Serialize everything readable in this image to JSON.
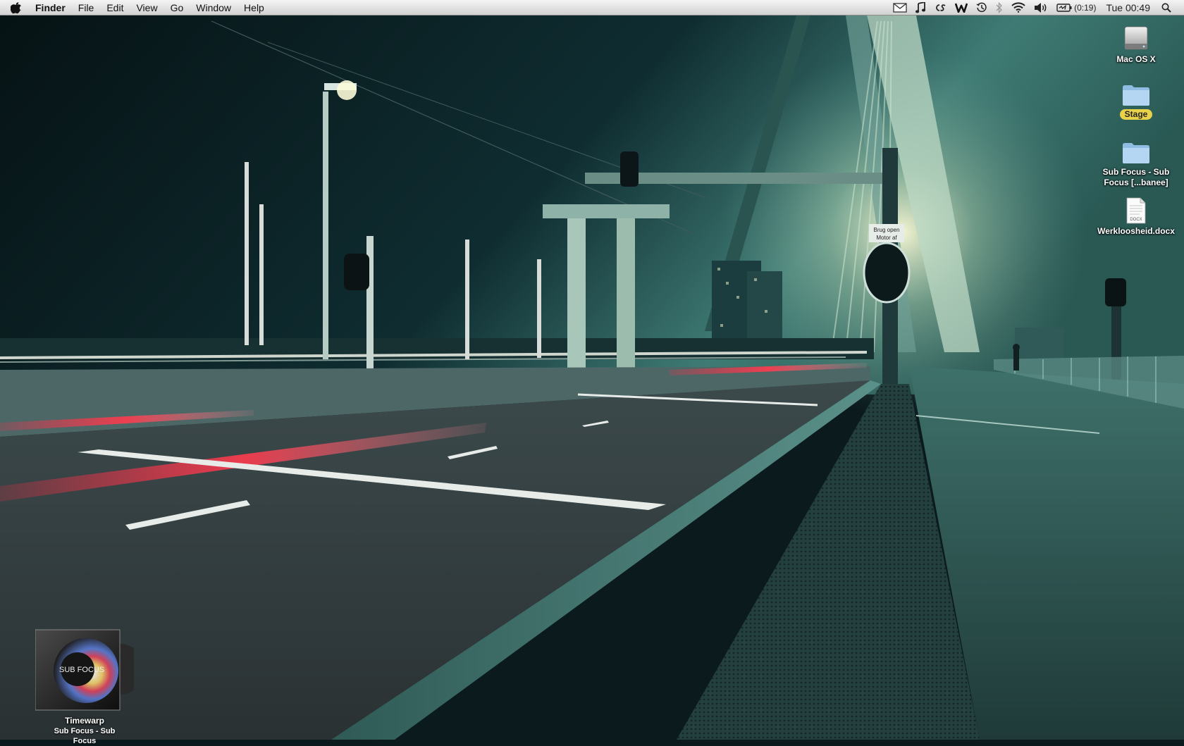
{
  "menubar": {
    "app_name": "Finder",
    "menus": [
      "File",
      "Edit",
      "View",
      "Go",
      "Window",
      "Help"
    ],
    "battery_time": "(0:19)",
    "clock": "Tue 00:49",
    "icons": {
      "apple": "apple-logo-icon",
      "mail": "envelope-icon",
      "music": "music-note-icon",
      "cs": "cs-monogram-icon",
      "word": "word-w-icon",
      "time_machine": "time-machine-icon",
      "bluetooth": "bluetooth-icon",
      "wifi": "wifi-icon",
      "volume": "speaker-icon",
      "battery": "battery-charging-icon",
      "spotlight": "magnifier-icon"
    }
  },
  "desktop": {
    "items": [
      {
        "label": "Mac OS X",
        "kind": "hard-drive-icon"
      },
      {
        "label": "Stage",
        "kind": "folder-icon",
        "tag_color": "#e9d14a"
      },
      {
        "label": "Sub Focus - Sub Focus [...banee]",
        "kind": "folder-icon"
      },
      {
        "label": "Werkloosheid.docx",
        "kind": "docx-document-icon",
        "badge": "DOCX"
      }
    ],
    "album": {
      "title": "Timewarp",
      "artist": "Sub Focus - Sub Focus",
      "cover_text": "SUB FOCUS"
    }
  },
  "wallpaper": {
    "sign_text_1": "Brug open",
    "sign_text_2": "Motor af"
  },
  "colors": {
    "sky": "#0a1f24",
    "menubar": "#e4e4e4",
    "tag": "#e9d14a",
    "taillight": "#ff3b4e"
  }
}
